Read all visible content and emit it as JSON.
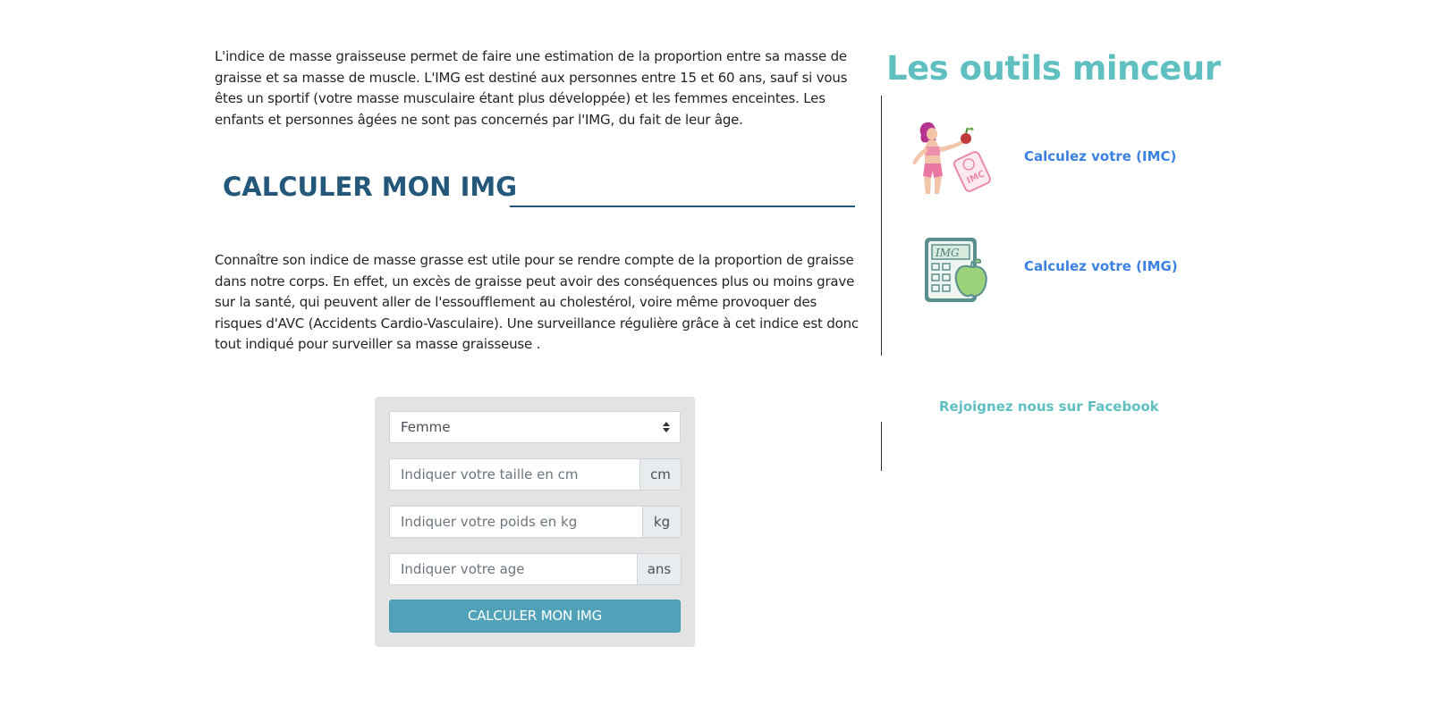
{
  "main": {
    "intro": "L'indice de masse graisseuse permet de faire une estimation de la proportion entre sa masse de graisse et sa masse de muscle. L'IMG est destiné aux personnes entre 15 et 60 ans, sauf si vous êtes un sportif (votre masse musculaire étant plus développée) et les femmes enceintes. Les enfants et personnes âgées ne sont pas concernés par l'IMG, du fait de leur âge.",
    "section_title": "CALCULER MON IMG",
    "body": "Connaître son indice de masse grasse est utile pour se rendre compte de la proportion de graisse dans notre corps. En effet, un excès de graisse peut avoir des conséquences plus ou moins grave sur la santé, qui peuvent aller de l'essoufflement au cholestérol, voire même provoquer des risques d'AVC (Accidents Cardio-Vasculaire). Une surveillance régulière grâce à cet indice est donc tout indiqué pour surveiller sa masse graisseuse ."
  },
  "form": {
    "sex_select_value": "Femme",
    "height_placeholder": "Indiquer votre taille en cm",
    "height_unit": "cm",
    "weight_placeholder": "Indiquer votre poids en kg",
    "weight_unit": "kg",
    "age_placeholder": "Indiquer votre age",
    "age_unit": "ans",
    "submit_label": "CALCULER MON IMG"
  },
  "sidebar": {
    "title": "Les outils minceur",
    "tools": [
      {
        "label": "Calculez votre (IMC)",
        "icon": "woman-scale-imc-icon",
        "icon_text": "IMC"
      },
      {
        "label": "Calculez votre (IMG)",
        "icon": "calculator-apple-img-icon",
        "icon_text": "IMG"
      }
    ],
    "facebook_label": "Rejoignez nous sur Facebook"
  },
  "colors": {
    "title_blue": "#24587a",
    "accent_teal": "#5fbfc1",
    "link_blue": "#3b82e0",
    "button": "#51a2b8"
  }
}
